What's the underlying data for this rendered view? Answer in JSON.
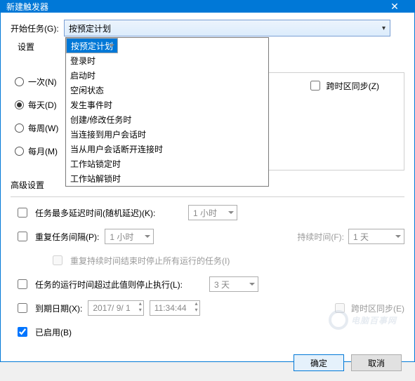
{
  "title": "新建触发器",
  "begin_task_label": "开始任务(G):",
  "combo_selected": "按预定计划",
  "dropdown_options": [
    "按预定计划",
    "登录时",
    "启动时",
    "空闲状态",
    "发生事件时",
    "创建/修改任务时",
    "当连接到用户会话时",
    "当从用户会话断开连接时",
    "工作站锁定时",
    "工作站解锁时"
  ],
  "settings_label": "设置",
  "radios": {
    "once": "一次(N)",
    "daily": "每天(D)",
    "weekly": "每周(W)",
    "monthly": "每月(M)"
  },
  "sync_tz": "跨时区同步(Z)",
  "advanced_label": "高级设置",
  "adv": {
    "delay_label": "任务最多延迟时间(随机延迟)(K):",
    "delay_value": "1 小时",
    "repeat_label": "重复任务间隔(P):",
    "repeat_value": "1 小时",
    "duration_label": "持续时间(F):",
    "duration_value": "1 天",
    "stop_running_label": "重复持续时间结束时停止所有运行的任务(I)",
    "stop_after_label": "任务的运行时间超过此值则停止执行(L):",
    "stop_after_value": "3 天",
    "expire_label": "到期日期(X):",
    "expire_date": "2017/ 9/ 1",
    "expire_time": "11:34:44",
    "expire_sync": "跨时区同步(E)",
    "enabled_label": "已启用(B)"
  },
  "buttons": {
    "ok": "确定",
    "cancel": "取消"
  },
  "watermark": "电脑百事网"
}
